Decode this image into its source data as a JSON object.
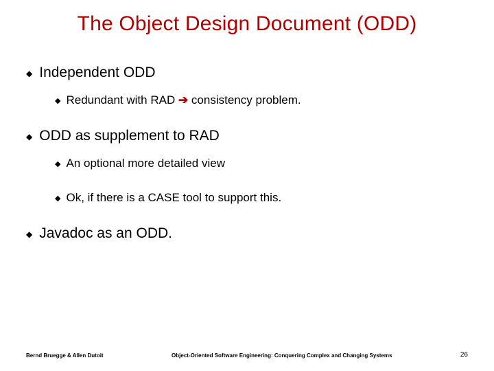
{
  "title": "The Object Design Document (ODD)",
  "bullets": [
    {
      "text": "Independent ODD",
      "sub": [
        {
          "pre": "Redundant with RAD ",
          "arrow": "è",
          "post": " consistency problem."
        }
      ]
    },
    {
      "text": "ODD as supplement to RAD",
      "sub": [
        {
          "pre": "An optional more detailed view",
          "arrow": "",
          "post": ""
        },
        {
          "pre": "Ok, if there is a CASE tool to support this.",
          "arrow": "",
          "post": ""
        }
      ]
    },
    {
      "text": "Javadoc as an ODD.",
      "sub": []
    }
  ],
  "footer": {
    "left": "Bernd Bruegge & Allen Dutoit",
    "center": "Object-Oriented Software Engineering: Conquering Complex and Changing Systems",
    "right": "26"
  },
  "glyphs": {
    "diamond": "◆",
    "subbullet": "◆"
  }
}
